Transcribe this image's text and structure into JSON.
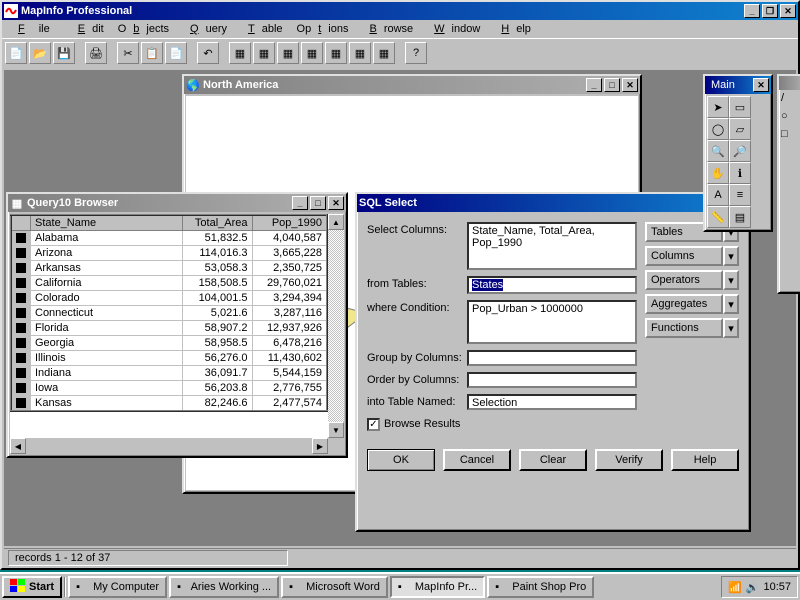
{
  "app": {
    "title": "MapInfo Professional",
    "menus": [
      "File",
      "Edit",
      "Objects",
      "Query",
      "Table",
      "Options",
      "Browse",
      "Window",
      "Help"
    ],
    "status": "records 1 - 12 of 37"
  },
  "map_window": {
    "title": "North America"
  },
  "browser_window": {
    "title": "Query10 Browser",
    "columns": [
      "State_Name",
      "Total_Area",
      "Pop_1990"
    ],
    "rows": [
      {
        "name": "Alabama",
        "area": "51,832.5",
        "pop": "4,040,587"
      },
      {
        "name": "Arizona",
        "area": "114,016.3",
        "pop": "3,665,228"
      },
      {
        "name": "Arkansas",
        "area": "53,058.3",
        "pop": "2,350,725"
      },
      {
        "name": "California",
        "area": "158,508.5",
        "pop": "29,760,021"
      },
      {
        "name": "Colorado",
        "area": "104,001.5",
        "pop": "3,294,394"
      },
      {
        "name": "Connecticut",
        "area": "5,021.6",
        "pop": "3,287,116"
      },
      {
        "name": "Florida",
        "area": "58,907.2",
        "pop": "12,937,926"
      },
      {
        "name": "Georgia",
        "area": "58,958.5",
        "pop": "6,478,216"
      },
      {
        "name": "Illinois",
        "area": "56,276.0",
        "pop": "11,430,602"
      },
      {
        "name": "Indiana",
        "area": "36,091.7",
        "pop": "5,544,159"
      },
      {
        "name": "Iowa",
        "area": "56,203.8",
        "pop": "2,776,755"
      },
      {
        "name": "Kansas",
        "area": "82,246.6",
        "pop": "2,477,574"
      }
    ]
  },
  "sql_dialog": {
    "title": "SQL Select",
    "labels": {
      "select_columns": "Select Columns:",
      "from_tables": "from Tables:",
      "where_condition": "where Condition:",
      "group_by": "Group by Columns:",
      "order_by": "Order by Columns:",
      "into_table": "into Table Named:",
      "browse_results": "Browse Results"
    },
    "values": {
      "select_columns": "State_Name, Total_Area, Pop_1990",
      "from_tables": "States",
      "where_condition": "Pop_Urban > 1000000",
      "group_by": "",
      "order_by": "",
      "into_table": "Selection",
      "browse_checked": "✓"
    },
    "side_buttons": [
      "Tables",
      "Columns",
      "Operators",
      "Aggregates",
      "Functions"
    ],
    "buttons": {
      "ok": "OK",
      "cancel": "Cancel",
      "clear": "Clear",
      "verify": "Verify",
      "help": "Help"
    }
  },
  "main_palette": {
    "title": "Main"
  },
  "taskbar": {
    "start": "Start",
    "items": [
      {
        "label": "My Computer",
        "active": false
      },
      {
        "label": "Aries Working ...",
        "active": false
      },
      {
        "label": "Microsoft Word",
        "active": false
      },
      {
        "label": "MapInfo Pr...",
        "active": true
      },
      {
        "label": "Paint Shop Pro",
        "active": false
      }
    ],
    "clock": "10:57"
  }
}
